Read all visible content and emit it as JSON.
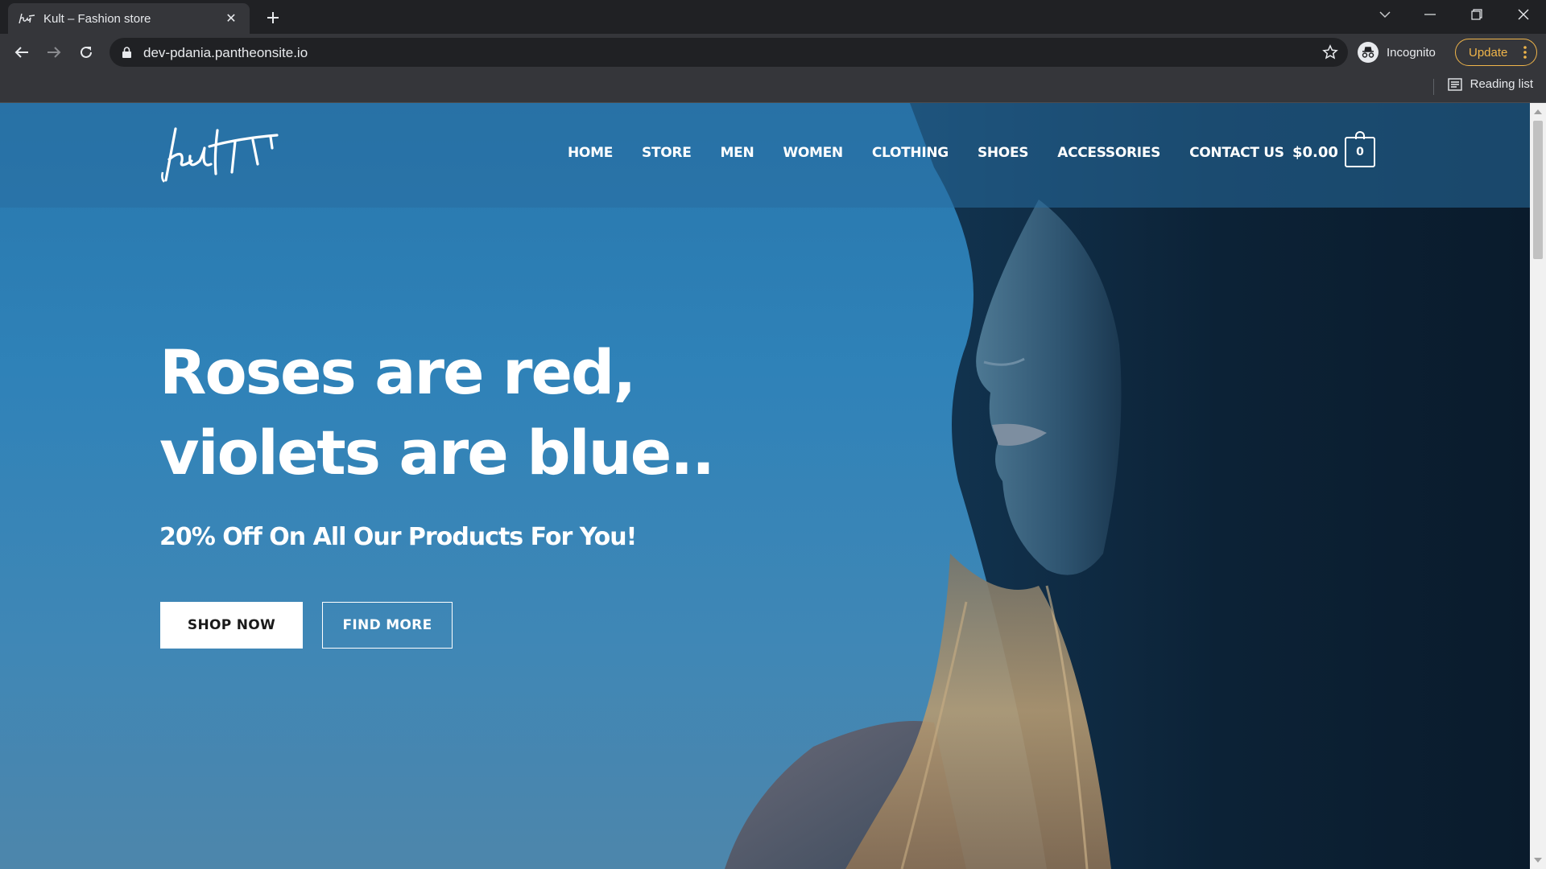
{
  "browser": {
    "tab_title": "Kult – Fashion store",
    "url": "dev-pdania.pantheonsite.io",
    "incognito_label": "Incognito",
    "update_label": "Update",
    "reading_list_label": "Reading list"
  },
  "site": {
    "nav": [
      "HOME",
      "STORE",
      "MEN",
      "WOMEN",
      "CLOTHING",
      "SHOES",
      "ACCESSORIES",
      "CONTACT US"
    ],
    "cart_total": "$0.00",
    "cart_count": "0"
  },
  "hero": {
    "headline_line1": "Roses are red,",
    "headline_line2": "violets are blue..",
    "subheadline": "20% Off On All Our Products For You!",
    "primary_button": "SHOP NOW",
    "secondary_button": "FIND MORE"
  },
  "colors": {
    "sky_blue": "#2f82b8",
    "hood_navy": "#0c2236",
    "update_accent": "#f0b54a"
  }
}
